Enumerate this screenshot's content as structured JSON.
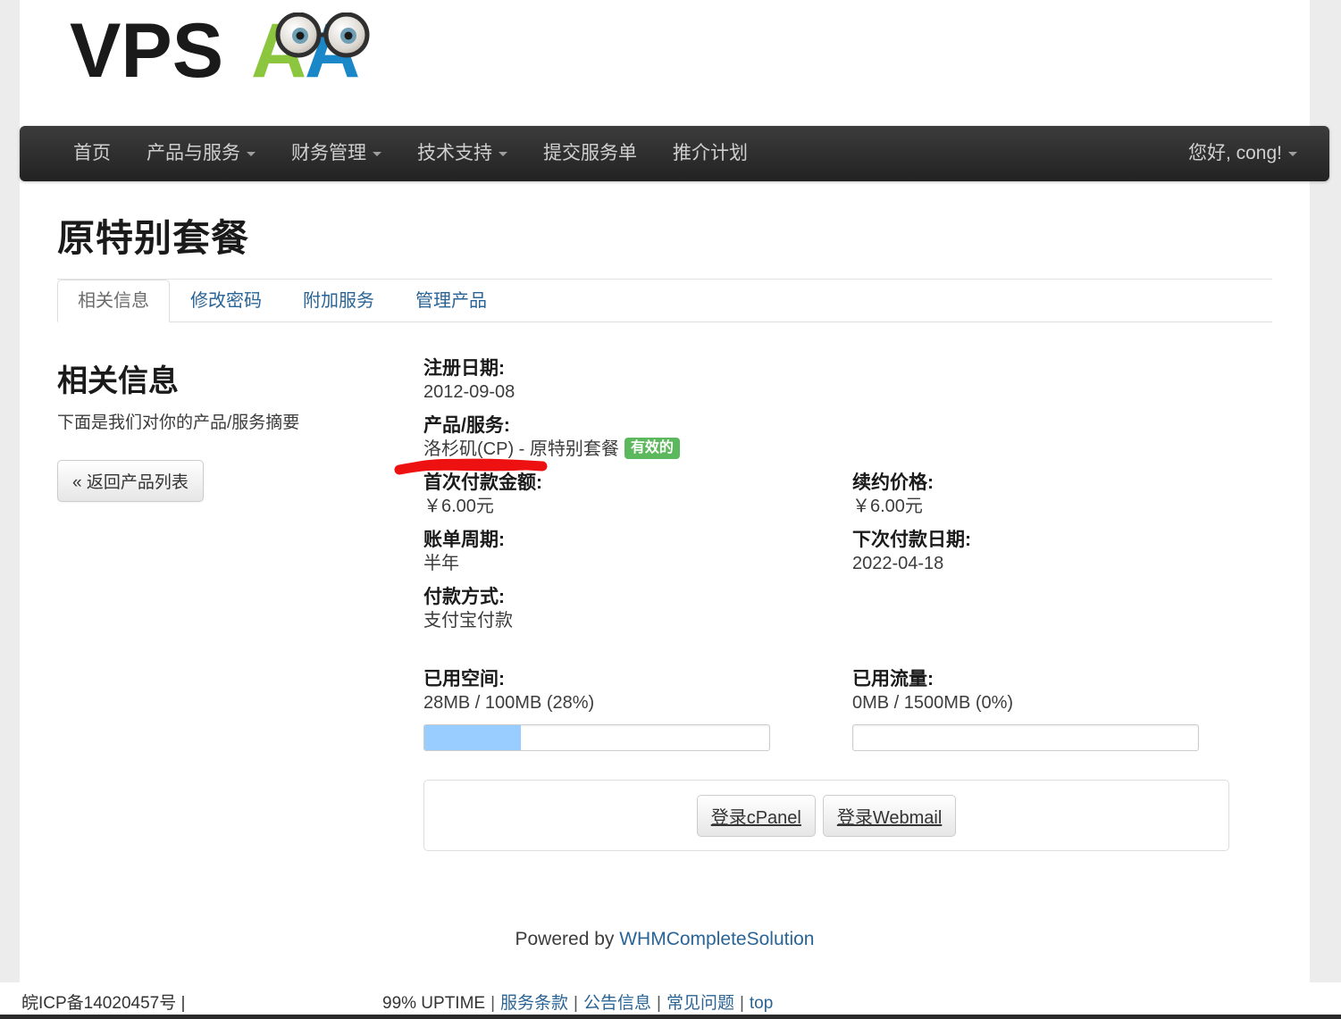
{
  "brand": {
    "logo_text_dark": "VPS",
    "logo_letter_green": "A",
    "logo_letter_blue": "A",
    "color_green": "#8cc63f",
    "color_blue": "#1a87c8",
    "color_dark": "#1a1a1a"
  },
  "nav": {
    "items": [
      {
        "label": "首页",
        "has_caret": false
      },
      {
        "label": "产品与服务",
        "has_caret": true
      },
      {
        "label": "财务管理",
        "has_caret": true
      },
      {
        "label": "技术支持",
        "has_caret": true
      },
      {
        "label": "提交服务单",
        "has_caret": false
      },
      {
        "label": "推介计划",
        "has_caret": false
      }
    ],
    "user_greeting": "您好, cong!"
  },
  "page": {
    "title": "原特别套餐"
  },
  "tabs": [
    {
      "label": "相关信息",
      "active": true
    },
    {
      "label": "修改密码",
      "active": false
    },
    {
      "label": "附加服务",
      "active": false
    },
    {
      "label": "管理产品",
      "active": false
    }
  ],
  "sidebar": {
    "heading": "相关信息",
    "subtitle": "下面是我们对你的产品/服务摘要",
    "back_button": "« 返回产品列表"
  },
  "details": {
    "register_date_label": "注册日期:",
    "register_date_value": "2012-09-08",
    "product_label": "产品/服务:",
    "product_value": "洛杉矶(CP) - 原特别套餐",
    "product_status_badge": "有效的",
    "first_payment_label": "首次付款金额:",
    "first_payment_value": "￥6.00元",
    "billing_cycle_label": "账单周期:",
    "billing_cycle_value": "半年",
    "payment_method_label": "付款方式:",
    "payment_method_value": "支付宝付款",
    "renewal_price_label": "续约价格:",
    "renewal_price_value": "￥6.00元",
    "next_due_label": "下次付款日期:",
    "next_due_value": "2022-04-18"
  },
  "usage": {
    "disk_label": "已用空间:",
    "disk_value": "28MB / 100MB (28%)",
    "disk_percent": 28,
    "bandwidth_label": "已用流量:",
    "bandwidth_value": "0MB / 1500MB (0%)",
    "bandwidth_percent": 0,
    "bar_color": "#99ccff"
  },
  "actions": {
    "cpanel_button": "登录cPanel",
    "webmail_button": "登录Webmail"
  },
  "footer": {
    "powered_prefix": "Powered by ",
    "powered_link": "WHMCompleteSolution"
  },
  "bottombar": {
    "icp": "皖ICP备14020457号 |",
    "uptime": "99% UPTIME",
    "links": [
      "服务条款",
      "公告信息",
      "常见问题",
      "top"
    ]
  }
}
